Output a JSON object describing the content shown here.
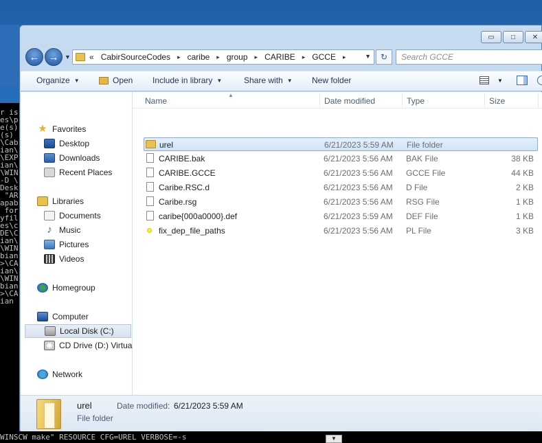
{
  "console": {
    "lines": [
      "r is",
      "es\\p",
      "",
      "",
      "",
      "",
      "",
      "",
      "",
      "",
      "e(s)",
      "(s)",
      "",
      "\\Cab",
      "ian\\",
      "\\EXP",
      "",
      "ian\\",
      "\\WIN",
      "-D \\",
      "",
      "",
      "Desk",
      " \"AR",
      "apab",
      " for",
      "",
      "yfil",
      "es\\c",
      "DE\\C",
      "ian\\",
      "\\WIN",
      "bian",
      ">\\CA",
      "ian\\",
      "\\WIN",
      "bian",
      ">\\CA",
      "ian"
    ],
    "bottom_line": "WINSCW make\" RESOURCE CFG=UREL VERBOSE=-s"
  },
  "window": {
    "controls": {
      "minimize": "▭",
      "maximize": "□",
      "close": "✕"
    }
  },
  "address": {
    "prefix": "«",
    "crumbs": [
      "CabirSourceCodes",
      "caribe",
      "group",
      "CARIBE",
      "GCCE"
    ],
    "separator": "▸",
    "search_placeholder": "Search GCCE"
  },
  "toolbar": {
    "organize": "Organize",
    "open": "Open",
    "include": "Include in library",
    "share": "Share with",
    "new_folder": "New folder"
  },
  "navpane": {
    "favorites": "Favorites",
    "desktop": "Desktop",
    "downloads": "Downloads",
    "recent": "Recent Places",
    "libraries": "Libraries",
    "documents": "Documents",
    "music": "Music",
    "pictures": "Pictures",
    "videos": "Videos",
    "homegroup": "Homegroup",
    "computer": "Computer",
    "local_disk": "Local Disk (C:)",
    "cd_drive": "CD Drive (D:) Virtual",
    "network": "Network"
  },
  "columns": {
    "name": "Name",
    "date": "Date modified",
    "type": "Type",
    "size": "Size"
  },
  "files": [
    {
      "name": "urel",
      "date": "6/21/2023 5:59 AM",
      "type": "File folder",
      "size": "",
      "icon": "folder-icon"
    },
    {
      "name": "CARIBE.bak",
      "date": "6/21/2023 5:56 AM",
      "type": "BAK File",
      "size": "38 KB",
      "icon": "file-icon"
    },
    {
      "name": "CARIBE.GCCE",
      "date": "6/21/2023 5:56 AM",
      "type": "GCCE File",
      "size": "44 KB",
      "icon": "file-icon"
    },
    {
      "name": "Caribe.RSC.d",
      "date": "6/21/2023 5:56 AM",
      "type": "D File",
      "size": "2 KB",
      "icon": "file-icon"
    },
    {
      "name": "Caribe.rsg",
      "date": "6/21/2023 5:56 AM",
      "type": "RSG File",
      "size": "1 KB",
      "icon": "file-icon"
    },
    {
      "name": "caribe{000a0000}.def",
      "date": "6/21/2023 5:59 AM",
      "type": "DEF File",
      "size": "1 KB",
      "icon": "file-icon"
    },
    {
      "name": "fix_dep_file_paths",
      "date": "6/21/2023 5:56 AM",
      "type": "PL File",
      "size": "3 KB",
      "icon": "perl-script-icon"
    }
  ],
  "details": {
    "name": "urel",
    "type": "File folder",
    "date_label": "Date modified:",
    "date_value": "6/21/2023 5:59 AM"
  }
}
